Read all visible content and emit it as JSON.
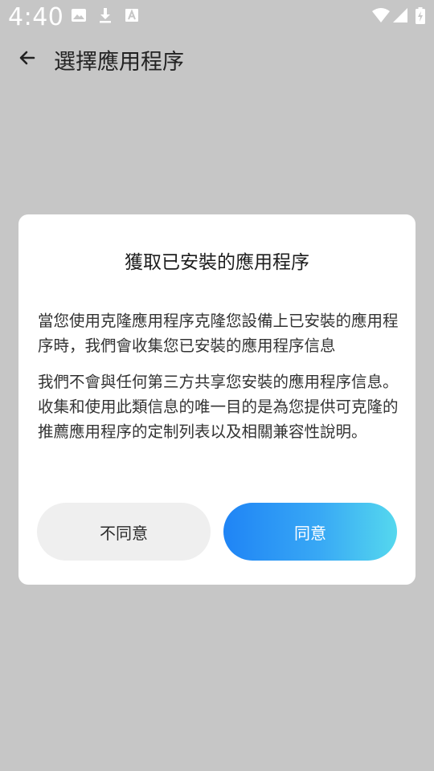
{
  "status_bar": {
    "time": "4:40",
    "left_icons": [
      "image-icon",
      "download-icon",
      "keyboard-a-icon"
    ],
    "right_icons": [
      "wifi-icon",
      "signal-icon",
      "battery-charging-icon"
    ]
  },
  "app_bar": {
    "back_icon": "arrow-left-icon",
    "title": "選擇應用程序"
  },
  "dialog": {
    "title": "獲取已安裝的應用程序",
    "paragraph_1": "當您使用克隆應用程序克隆您設備上已安裝的應用程序時，我們會收集您已安裝的應用程序信息",
    "paragraph_2": "我們不會與任何第三方共享您安裝的應用程序信息。 收集和使用此類信息的唯一目的是為您提供可克隆的推薦應用程序的定制列表以及相關兼容性說明。",
    "disagree_label": "不同意",
    "agree_label": "同意"
  },
  "colors": {
    "background_dim": "#c6c6c6",
    "dialog_bg": "#ffffff",
    "disagree_bg": "#efefef",
    "agree_gradient_start": "#1f84f5",
    "agree_gradient_end": "#55d8ee"
  }
}
